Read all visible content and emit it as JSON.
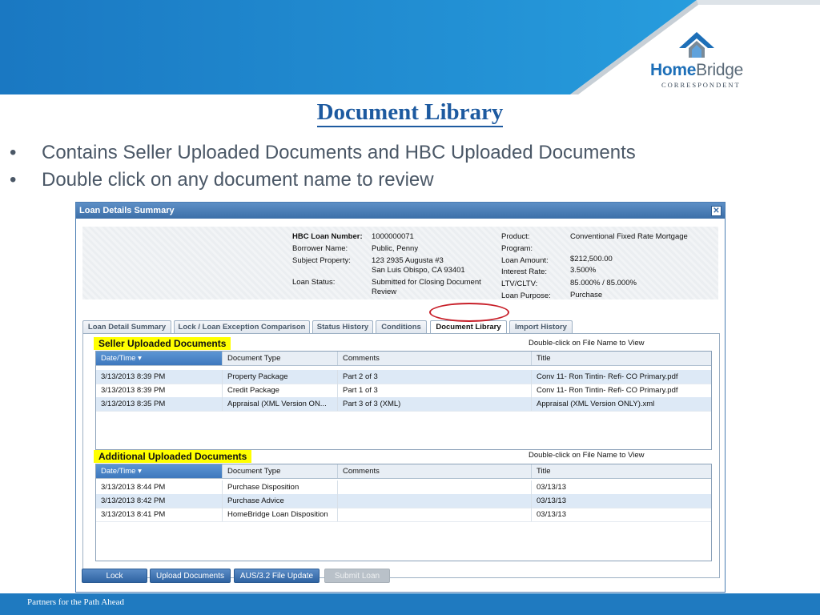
{
  "brand": {
    "name_part1": "Home",
    "name_part2": "Bridge",
    "subtitle": "CORRESPONDENT",
    "colors": {
      "banner": "#1a78c2",
      "footer": "#1f7ac0",
      "title": "#1d5aa0",
      "highlight": "#ffff00"
    }
  },
  "page_title": "Document Library",
  "bullets": [
    "Contains Seller Uploaded Documents and HBC Uploaded Documents",
    "Double click on any document name to review"
  ],
  "window": {
    "title": "Loan Details Summary",
    "close_icon": "✕"
  },
  "loan": {
    "labels": {
      "loan_number": "HBC Loan Number:",
      "borrower": "Borrower Name:",
      "property": "Subject Property:",
      "status": "Loan Status:",
      "product": "Product:",
      "program": "Program:",
      "amount": "Loan Amount:",
      "rate": "Interest Rate:",
      "ltv": "LTV/CLTV:",
      "purpose": "Loan Purpose:"
    },
    "values": {
      "loan_number": "1000000071",
      "borrower": "Public, Penny",
      "property_line1": "123 2935 Augusta #3",
      "property_line2": "San Luis Obispo, CA 93401",
      "status_line1": "Submitted for Closing Document",
      "status_line2": "Review",
      "product": "Conventional Fixed Rate Mortgage",
      "program": "",
      "amount": "$212,500.00",
      "rate": "3.500%",
      "ltv": "85.000% / 85.000%",
      "purpose": "Purchase"
    }
  },
  "tabs": [
    {
      "label": "Loan Detail Summary",
      "active": false
    },
    {
      "label": "Lock / Loan Exception Comparison",
      "active": false
    },
    {
      "label": "Status History",
      "active": false
    },
    {
      "label": "Conditions",
      "active": false
    },
    {
      "label": "Document Library",
      "active": true
    },
    {
      "label": "Import History",
      "active": false
    }
  ],
  "seller": {
    "label": "Seller Uploaded Documents",
    "hint": "Double-click on File Name to View",
    "columns": [
      "Date/Time ▾",
      "Document Type",
      "Comments",
      "Title"
    ],
    "rows": [
      [
        "3/13/2013 8:39 PM",
        "Property Package",
        "Part 2 of 3",
        "Conv 11- Ron Tintin- Refi- CO Primary.pdf"
      ],
      [
        "3/13/2013 8:39 PM",
        "Credit Package",
        "Part 1 of 3",
        "Conv 11- Ron Tintin- Refi- CO Primary.pdf"
      ],
      [
        "3/13/2013 8:35 PM",
        "Appraisal (XML Version ON...",
        "Part 3 of 3 (XML)",
        "Appraisal (XML Version ONLY).xml"
      ]
    ]
  },
  "additional": {
    "label": "Additional Uploaded Documents",
    "hint": "Double-click on File Name to View",
    "columns": [
      "Date/Time ▾",
      "Document Type",
      "Comments",
      "Title"
    ],
    "rows": [
      [
        "3/13/2013 8:44 PM",
        "Purchase Disposition",
        "",
        "03/13/13"
      ],
      [
        "3/13/2013 8:42 PM",
        "Purchase Advice",
        "",
        "03/13/13"
      ],
      [
        "3/13/2013 8:41 PM",
        "HomeBridge Loan Disposition",
        "",
        "03/13/13"
      ]
    ]
  },
  "buttons": {
    "lock": "Lock",
    "upload": "Upload Documents",
    "aus": "AUS/3.2 File Update",
    "submit": "Submit Loan"
  },
  "footer": "Partners for the Path Ahead"
}
